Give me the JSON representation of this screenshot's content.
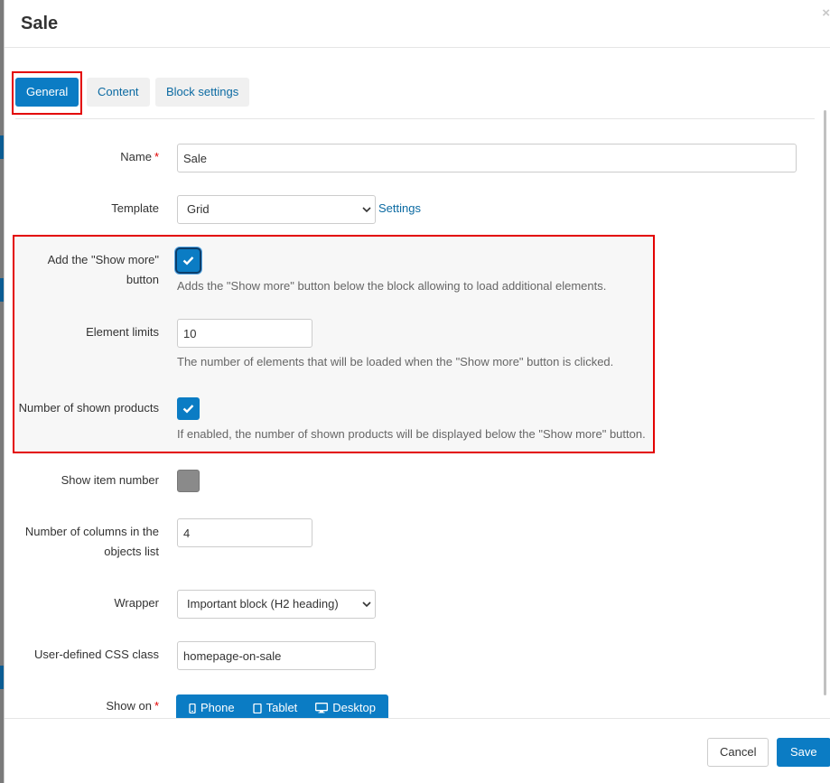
{
  "dialog": {
    "title": "Sale",
    "close_glyph": "×"
  },
  "tabs": [
    {
      "label": "General",
      "active": true
    },
    {
      "label": "Content",
      "active": false
    },
    {
      "label": "Block settings",
      "active": false
    }
  ],
  "form": {
    "name": {
      "label": "Name",
      "required_mark": "*",
      "value": "Sale"
    },
    "template": {
      "label": "Template",
      "value": "Grid",
      "settings_link": "Settings"
    },
    "show_more": {
      "label_line1": "Add the \"Show more\"",
      "label_line2": "button",
      "checked": true,
      "help": "Adds the \"Show more\" button below the block allowing to load additional elements."
    },
    "element_limits": {
      "label": "Element limits",
      "value": "10",
      "help": "The number of elements that will be loaded when the \"Show more\" button is clicked."
    },
    "shown_products": {
      "label": "Number of shown products",
      "checked": true,
      "help": "If enabled, the number of shown products will be displayed below the \"Show more\" button."
    },
    "show_item_number": {
      "label": "Show item number",
      "checked": false
    },
    "columns": {
      "label_line1": "Number of columns in the",
      "label_line2": "objects list",
      "value": "4"
    },
    "wrapper": {
      "label": "Wrapper",
      "value": "Important block (H2 heading)"
    },
    "css_class": {
      "label": "User-defined CSS class",
      "value": "homepage-on-sale"
    },
    "show_on": {
      "label": "Show on",
      "required_mark": "*",
      "options": [
        {
          "label": "Phone",
          "icon": "phone-icon"
        },
        {
          "label": "Tablet",
          "icon": "tablet-icon"
        },
        {
          "label": "Desktop",
          "icon": "desktop-icon"
        }
      ]
    }
  },
  "footer": {
    "cancel_label": "Cancel",
    "save_label": "Save"
  },
  "colors": {
    "accent": "#0b7cc4",
    "highlight": "#e30000",
    "link": "#0b6aa2"
  }
}
